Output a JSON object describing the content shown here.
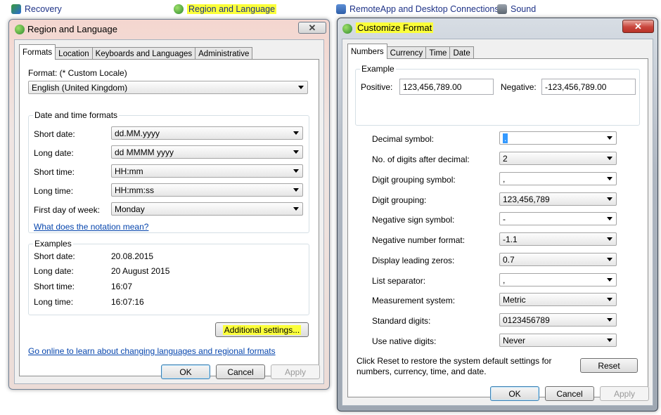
{
  "control_panel": {
    "recovery": "Recovery",
    "region_language": "Region and Language",
    "remoteapp": "RemoteApp and Desktop Connections",
    "sound": "Sound"
  },
  "region_dialog": {
    "title": "Region and Language",
    "tabs": [
      "Formats",
      "Location",
      "Keyboards and Languages",
      "Administrative"
    ],
    "format_label": "Format: (* Custom Locale)",
    "format_value": "English (United Kingdom)",
    "datetime_group": "Date and time formats",
    "fields": [
      {
        "label": "Short date:",
        "value": "dd.MM.yyyy"
      },
      {
        "label": "Long date:",
        "value": "dd MMMM yyyy"
      },
      {
        "label": "Short time:",
        "value": "HH:mm"
      },
      {
        "label": "Long time:",
        "value": "HH:mm:ss"
      },
      {
        "label": "First day of week:",
        "value": "Monday"
      }
    ],
    "notation_link": "What does the notation mean?",
    "examples_group": "Examples",
    "examples": [
      {
        "label": "Short date:",
        "value": "20.08.2015"
      },
      {
        "label": "Long date:",
        "value": "20 August 2015"
      },
      {
        "label": "Short time:",
        "value": "16:07"
      },
      {
        "label": "Long time:",
        "value": "16:07:16"
      }
    ],
    "additional_settings": "Additional settings...",
    "online_link": "Go online to learn about changing languages and regional formats",
    "ok": "OK",
    "cancel": "Cancel",
    "apply": "Apply"
  },
  "customize_dialog": {
    "title": "Customize Format",
    "tabs": [
      "Numbers",
      "Currency",
      "Time",
      "Date"
    ],
    "example_group": "Example",
    "positive_label": "Positive:",
    "positive_value": "123,456,789.00",
    "negative_label": "Negative:",
    "negative_value": "-123,456,789.00",
    "settings": [
      {
        "label": "Decimal symbol:",
        "value": "."
      },
      {
        "label": "No. of digits after decimal:",
        "value": "2"
      },
      {
        "label": "Digit grouping symbol:",
        "value": ","
      },
      {
        "label": "Digit grouping:",
        "value": "123,456,789"
      },
      {
        "label": "Negative sign symbol:",
        "value": "-"
      },
      {
        "label": "Negative number format:",
        "value": "-1.1"
      },
      {
        "label": "Display leading zeros:",
        "value": "0.7"
      },
      {
        "label": "List separator:",
        "value": ","
      },
      {
        "label": "Measurement system:",
        "value": "Metric"
      },
      {
        "label": "Standard digits:",
        "value": "0123456789"
      },
      {
        "label": "Use native digits:",
        "value": "Never"
      }
    ],
    "reset_text_1": "Click Reset to restore the system default settings for",
    "reset_text_2": "numbers, currency, time, and date.",
    "reset": "Reset",
    "ok": "OK",
    "cancel": "Cancel",
    "apply": "Apply"
  },
  "colors": {
    "highlight": "#fbff3a",
    "link": "#0645ad",
    "close_red": "#c9463d"
  }
}
